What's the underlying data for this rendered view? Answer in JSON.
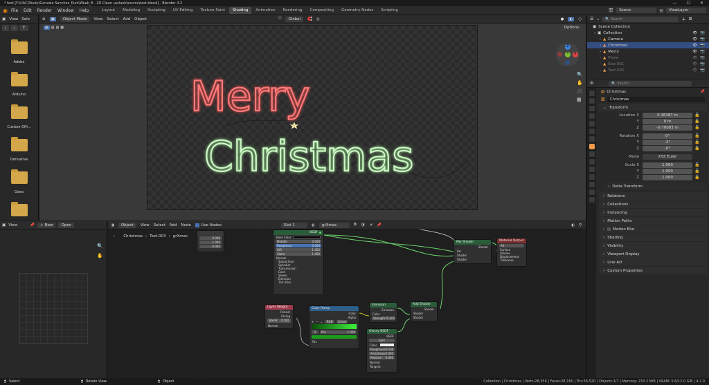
{
  "titlebar": {
    "title": "* test [F:\\UAC\\Study\\Gonzalo Sanchez_Ruiz\\Week_8 - 2D Clean up\\task\\source\\test.blend] - Blender 4.2"
  },
  "menu": [
    "File",
    "Edit",
    "Render",
    "Window",
    "Help"
  ],
  "workspaces": [
    "Layout",
    "Modeling",
    "Sculpting",
    "UV Editing",
    "Texture Paint",
    "Shading",
    "Animation",
    "Rendering",
    "Compositing",
    "Geometry Nodes",
    "Scripting"
  ],
  "active_workspace": "Shading",
  "scene": "Scene",
  "view_layer": "ViewLayer",
  "filebrowser": {
    "menu": [
      "View",
      "Sele"
    ],
    "folders": [
      "Adobe",
      "Arduino",
      "Custom Offi...",
      "Derivative",
      "Gaea",
      ""
    ]
  },
  "viewport": {
    "mode": "Object Mode",
    "menu": [
      "View",
      "Select",
      "Add",
      "Object"
    ],
    "orientation": "Global",
    "options": "Options",
    "text_line1": "Merry",
    "text_line2": "Christmas",
    "gizmo": {
      "x": "X",
      "y": "Y",
      "z": "Z"
    }
  },
  "image_editor": {
    "view": "View",
    "new": "New",
    "open": "Open"
  },
  "node_editor": {
    "editor_type": "Object",
    "menu": [
      "View",
      "Select",
      "Add",
      "Node"
    ],
    "use_nodes": "Use Nodes",
    "slot": "Slot 1",
    "material": "grXmas",
    "breadcrumb": [
      "Christmas",
      "Text.003",
      "grXmas"
    ],
    "small_node": {
      "rows": [
        "0.000",
        "1.000",
        "0.000"
      ]
    },
    "principled": {
      "title": "BSDF",
      "rows": [
        "Base Color",
        "Metallic",
        "Roughness",
        "IOR",
        "Alpha",
        "Normal",
        "Subsurface",
        "Specular",
        "Transmission",
        "Coat",
        "Sheen",
        "Emission",
        "Thin Film"
      ],
      "values": [
        "",
        "0.000",
        "0.500",
        "1.450",
        "1.000"
      ]
    },
    "layer_weight": {
      "title": "Layer Weight",
      "outs": [
        "Fresnel",
        "Facing"
      ],
      "blend_label": "Blend",
      "blend": "0.500",
      "normal": "Normal"
    },
    "color_ramp": {
      "title": "Color Ramp",
      "outs": [
        "Color",
        "Alpha"
      ],
      "mode": "RGB",
      "interp": "Linear",
      "pos_index": "1",
      "pos_label": "Pos",
      "pos": "1.000",
      "fac": "Fac"
    },
    "emission": {
      "title": "Emission",
      "out": "Emission",
      "color": "Color",
      "strength_label": "Strength",
      "strength": "25.000"
    },
    "add_shader": {
      "title": "Add Shader",
      "out": "Shader",
      "ins": [
        "Shader",
        "Shader"
      ]
    },
    "glossy": {
      "title": "Glossy BSDF",
      "out": "BSDF",
      "dist": "GGX",
      "rows": [
        "Color",
        "Roughness",
        "Anisotropy",
        "Rotation",
        "Normal",
        "Tangent"
      ],
      "values": [
        "",
        "0.500",
        "0.000",
        "0.000"
      ]
    },
    "mix_shader": {
      "title": "Mix Shader",
      "out": "Shader",
      "ins": [
        "Fac",
        "Shader",
        "Shader"
      ]
    },
    "output": {
      "title": "Material Output",
      "target": "All",
      "ins": [
        "Surface",
        "Volume",
        "Displacement",
        "Thickness"
      ]
    }
  },
  "outliner": {
    "search_placeholder": "Search",
    "root": "Scene Collection",
    "items": [
      {
        "name": "Collection",
        "level": 0
      },
      {
        "name": "Camera",
        "level": 1
      },
      {
        "name": "Christmas",
        "level": 1,
        "selected": true
      },
      {
        "name": "Merry",
        "level": 1
      },
      {
        "name": "Plane",
        "level": 1,
        "dim": true
      },
      {
        "name": "Star.001",
        "level": 1,
        "dim": true
      },
      {
        "name": "Text.001",
        "level": 1,
        "dim": true
      }
    ]
  },
  "properties": {
    "search_placeholder": "Search",
    "context": "Christmas",
    "object_name": "Christmas",
    "transform": "Transform",
    "location_label": "Location X",
    "location": [
      "0.18187 m",
      "0 m",
      "-0.70083 m"
    ],
    "rotation_label": "Rotation X",
    "rotation": [
      "0°",
      "-2°",
      "-0°"
    ],
    "mode_label": "Mode",
    "mode": "XYZ Euler",
    "scale_label": "Scale X",
    "scale": [
      "1.000",
      "1.000",
      "1.000"
    ],
    "axis_y": "Y",
    "axis_z": "Z",
    "delta": "Delta Transform",
    "panels": [
      "Relations",
      "Collections",
      "Instancing",
      "Motion Paths",
      "Motion Blur",
      "Shading",
      "Visibility",
      "Viewport Display",
      "Line Art",
      "Custom Properties"
    ]
  },
  "statusbar": {
    "select": "Select",
    "rotate": "Rotate View",
    "object": "Object",
    "stats": "Collection | Christmas | Verts:28,356 | Faces:28,160 | Tris:56,520 | Objects:1/7 | Memory: 233.2 MiB | VRAM: 5.6/12.0 GiB | 4.2.0"
  },
  "colors": {
    "neon_red": "#ff6b6b",
    "neon_green": "#c8f5c0",
    "accent": "#4772b3",
    "selected_row": "#334d80"
  }
}
